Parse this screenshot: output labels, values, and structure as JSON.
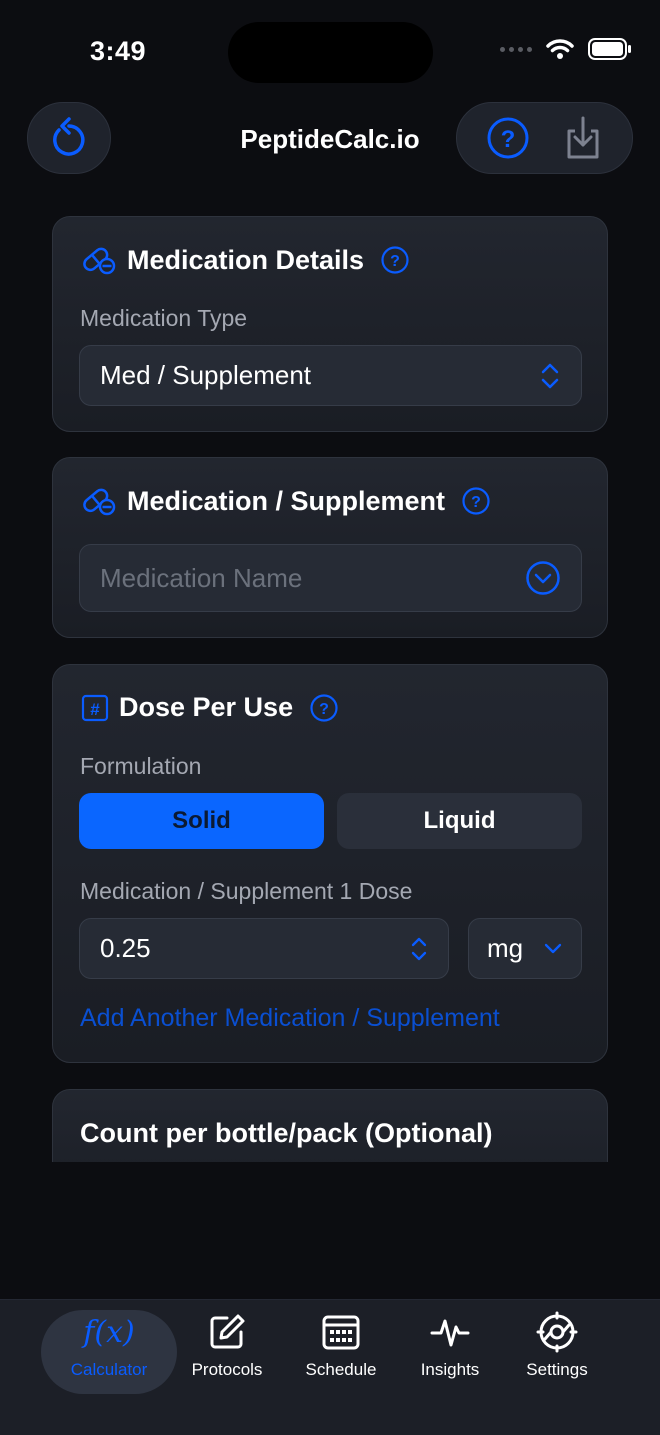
{
  "status_bar": {
    "time": "3:49"
  },
  "header": {
    "title": "PeptideCalc.io"
  },
  "colors": {
    "accent": "#0a5cff",
    "background": "#0c0d11",
    "card": "#1f232b"
  },
  "medication_details": {
    "title": "Medication Details",
    "type_label": "Medication Type",
    "type_value": "Med / Supplement"
  },
  "medication_supplement": {
    "title": "Medication / Supplement",
    "name_placeholder": "Medication Name"
  },
  "dose_per_use": {
    "title": "Dose Per Use",
    "formulation_label": "Formulation",
    "formulation_options": [
      "Solid",
      "Liquid"
    ],
    "formulation_selected": "Solid",
    "dose_label": "Medication / Supplement 1 Dose",
    "dose_value": "0.25",
    "unit": "mg",
    "add_link": "Add Another Medication / Supplement"
  },
  "count_card": {
    "title": "Count per bottle/pack (Optional)"
  },
  "tabs": [
    {
      "label": "Calculator",
      "icon": "function-icon",
      "active": true
    },
    {
      "label": "Protocols",
      "icon": "edit-icon",
      "active": false
    },
    {
      "label": "Schedule",
      "icon": "calendar-icon",
      "active": false
    },
    {
      "label": "Insights",
      "icon": "pulse-icon",
      "active": false
    },
    {
      "label": "Settings",
      "icon": "gear-icon",
      "active": false
    }
  ],
  "tab_icon_text": {
    "calculator": "f(x)"
  }
}
